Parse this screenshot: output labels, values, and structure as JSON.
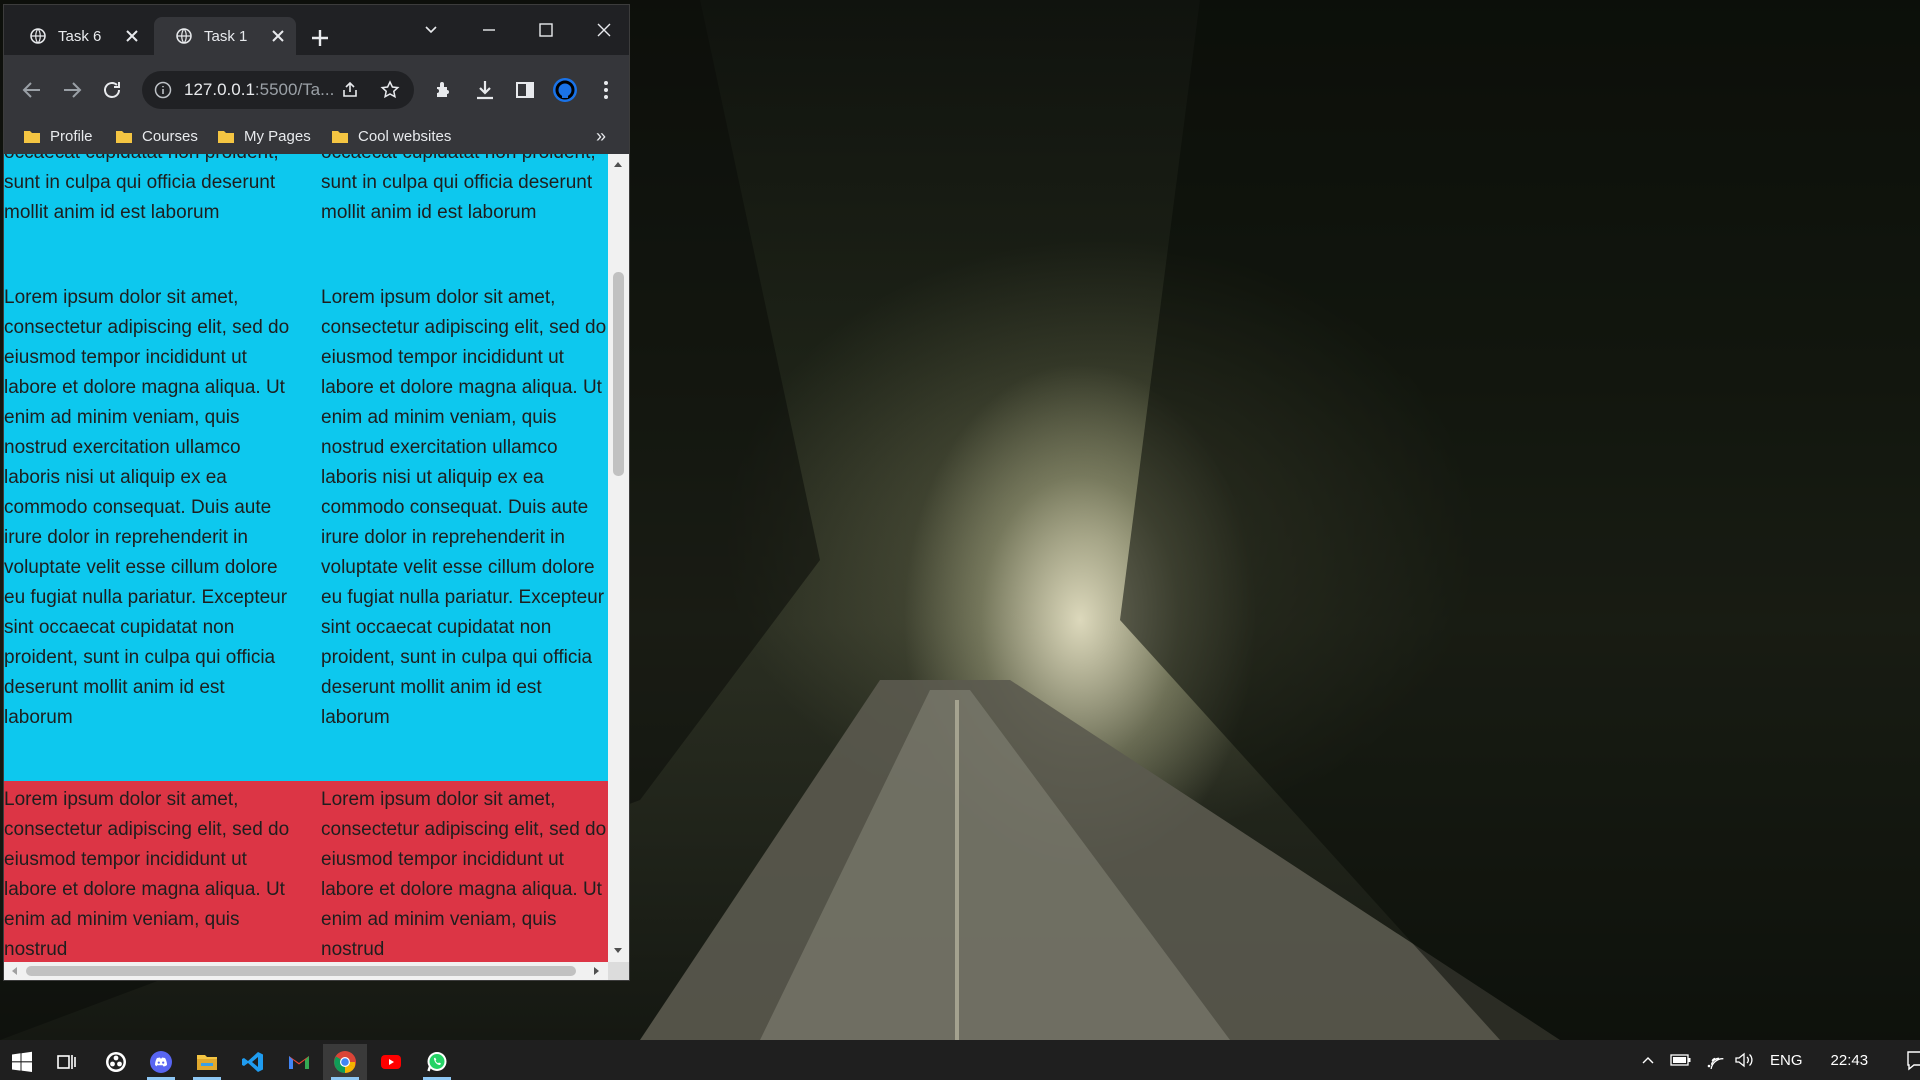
{
  "browser": {
    "tabs": [
      {
        "label": "Task 6",
        "active": false
      },
      {
        "label": "Task 1",
        "active": true
      }
    ],
    "address": {
      "host": "127.0.0.1",
      "path": ":5500/Ta..."
    },
    "bookmarks": [
      "Profile",
      "Courses",
      "My Pages",
      "Cool websites"
    ],
    "bookmark_overflow": "»"
  },
  "page": {
    "blue_color": "#0dc8ee",
    "red_color": "#dc3545",
    "top_partial_col1": "occaecat cupidatat non proident, sunt in culpa qui officia deserunt mollit anim id est laborum",
    "top_partial_col2": "occaecat cupidatat non proident, sunt in culpa qui officia deserunt mollit anim id est laborum",
    "blue_para_col1": "Lorem ipsum dolor sit amet, consectetur adipiscing elit, sed do eiusmod tempor incididunt ut labore et dolore magna aliqua. Ut enim ad minim veniam, quis nostrud exercitation ullamco laboris nisi ut aliquip ex ea commodo consequat. Duis aute irure dolor in reprehenderit in voluptate velit esse cillum dolore eu fugiat nulla pariatur. Excepteur sint occaecat cupidatat non proident, sunt in culpa qui officia deserunt mollit anim id est laborum",
    "blue_para_col2": "Lorem ipsum dolor sit amet, consectetur adipiscing elit, sed do eiusmod tempor incididunt ut labore et dolore magna aliqua. Ut enim ad minim veniam, quis nostrud exercitation ullamco laboris nisi ut aliquip ex ea commodo consequat. Duis aute irure dolor in reprehenderit in voluptate velit esse cillum dolore eu fugiat nulla pariatur. Excepteur sint occaecat cupidatat non proident, sunt in culpa qui officia deserunt mollit anim id est laborum",
    "red_para_col1": "Lorem ipsum dolor sit amet, consectetur adipiscing elit, sed do eiusmod tempor incididunt ut labore et dolore magna aliqua. Ut enim ad minim veniam, quis nostrud",
    "red_para_col2": "Lorem ipsum dolor sit amet, consectetur adipiscing elit, sed do eiusmod tempor incididunt ut labore et dolore magna aliqua. Ut enim ad minim veniam, quis nostrud"
  },
  "taskbar": {
    "apps": [
      "windows-start",
      "task-view",
      "obs",
      "discord",
      "file-explorer",
      "vscode",
      "gmail",
      "chrome",
      "youtube",
      "whatsapp"
    ],
    "language": "ENG",
    "time": "22:43"
  }
}
